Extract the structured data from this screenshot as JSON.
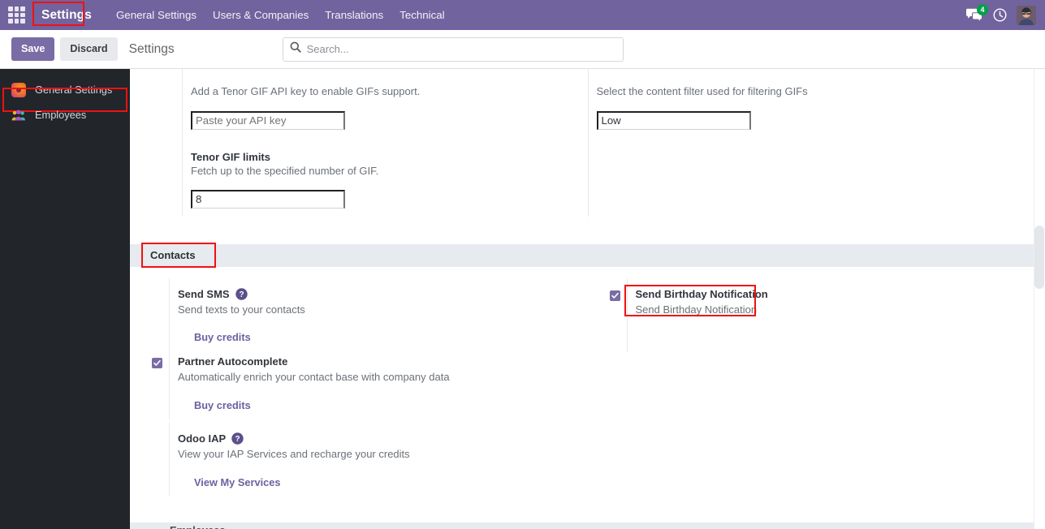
{
  "navbar": {
    "apps_icon": "apps-grid-icon",
    "brand": "Settings",
    "menus": [
      {
        "label": "General Settings"
      },
      {
        "label": "Users & Companies"
      },
      {
        "label": "Translations"
      },
      {
        "label": "Technical"
      }
    ],
    "messages_icon": "chat-bubble-icon",
    "messages_count": "4",
    "activities_icon": "clock-icon",
    "avatar_icon": "user-avatar",
    "accent_color": "#71639e",
    "badge_color": "#00a04a"
  },
  "controlbar": {
    "save_label": "Save",
    "discard_label": "Discard",
    "breadcrumb": "Settings",
    "save_color": "#7a6ca5"
  },
  "search": {
    "icon": "search-icon",
    "placeholder": "Search...",
    "value": ""
  },
  "sidebar": {
    "items": [
      {
        "label": "General Settings",
        "icon": "settings-app-icon",
        "active": true
      },
      {
        "label": "Employees",
        "icon": "employees-app-icon",
        "active": false
      }
    ]
  },
  "highlights": {
    "color": "#ef1111",
    "targets": [
      "navbar-brand",
      "sidebar-item-general-settings",
      "contacts-section-title",
      "send-birthday-notification"
    ]
  },
  "discuss_section": {
    "gif_api_help": "Add a Tenor GIF API key to enable GIFs support.",
    "gif_api_placeholder": "Paste your API key",
    "gif_api_value": "",
    "content_filter_help": "Select the content filter used for filtering GIFs",
    "content_filter_value": "Low",
    "gif_limits_title": "Tenor GIF limits",
    "gif_limits_desc": "Fetch up to the specified number of GIF.",
    "gif_limits_value": "8"
  },
  "contacts_section": {
    "title": "Contacts",
    "settings": [
      {
        "id": "send-sms",
        "label": "Send SMS",
        "description": "Send texts to your contacts",
        "has_help": true,
        "help_icon": "question-mark-icon",
        "checkbox": false,
        "link_label": "Buy credits"
      },
      {
        "id": "send-birthday-notification",
        "label": "Send Birthday Notification",
        "description": "Send Birthday Notification",
        "has_help": false,
        "checkbox": true,
        "link_label": ""
      },
      {
        "id": "partner-autocomplete",
        "label": "Partner Autocomplete",
        "description": "Automatically enrich your contact base with company data",
        "has_help": false,
        "checkbox": true,
        "link_label": "Buy credits"
      },
      {
        "id": "odoo-iap",
        "label": "Odoo IAP",
        "description": "View your IAP Services and recharge your credits",
        "has_help": true,
        "help_icon": "question-mark-icon",
        "checkbox": false,
        "link_label": "View My Services"
      }
    ]
  },
  "next_section": {
    "title_partial": "Employees"
  }
}
